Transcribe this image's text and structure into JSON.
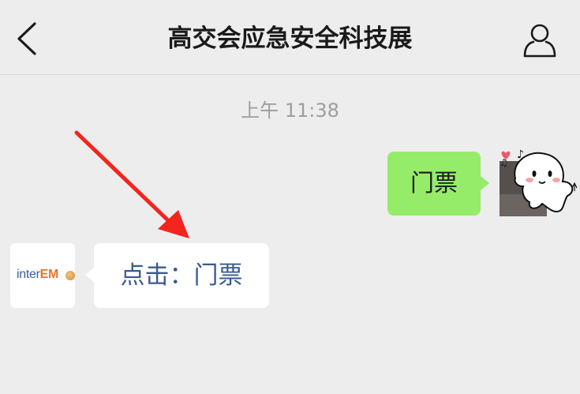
{
  "header": {
    "title": "高交会应急安全科技展",
    "back_icon": "chevron-left-icon",
    "profile_icon": "person-icon"
  },
  "chat": {
    "timestamp": "上午 11:38",
    "messages": [
      {
        "side": "right",
        "text": "门票",
        "bubble_color": "#95ec69"
      },
      {
        "side": "left",
        "text": "点击：门票",
        "text_color": "#3a5b8f"
      }
    ]
  },
  "left_avatar": {
    "logo_prefix": "inter",
    "logo_brand": "EM"
  },
  "annotation": {
    "arrow_color": "#f4241e"
  }
}
